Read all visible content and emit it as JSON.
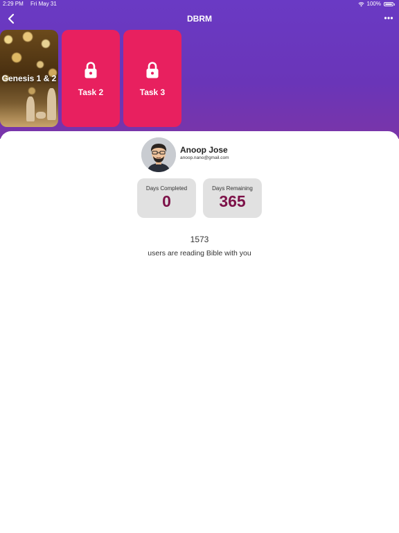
{
  "status_bar": {
    "time": "2:29 PM",
    "date": "Fri May 31",
    "battery": "100%"
  },
  "nav": {
    "title": "DBRM",
    "back_icon": "chevron-left-icon",
    "more_icon": "ellipsis-icon"
  },
  "tasks": [
    {
      "label": "Genesis 1 & 2",
      "locked": false
    },
    {
      "label": "Task 2",
      "locked": true
    },
    {
      "label": "Task 3",
      "locked": true
    }
  ],
  "profile": {
    "name": "Anoop Jose",
    "email": "anoop.nano@gmail.com"
  },
  "stats": [
    {
      "label": "Days Completed",
      "value": "0"
    },
    {
      "label": "Days Remaining",
      "value": "365"
    }
  ],
  "community": {
    "count": "1573",
    "caption": "users are reading Bible with you"
  },
  "colors": {
    "header": "#6a3ac4",
    "task_card": "#e8205f",
    "stat_value": "#7d1249",
    "stat_bg": "#e1e1e1"
  }
}
